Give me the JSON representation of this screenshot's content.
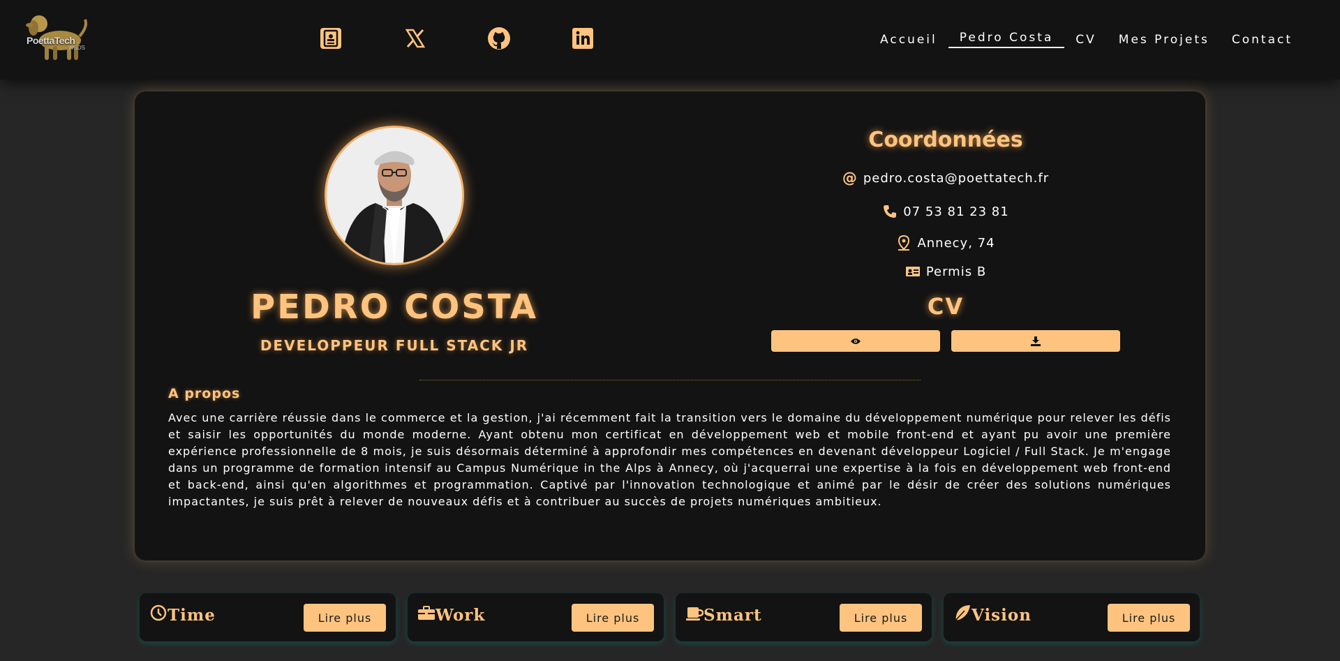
{
  "header": {
    "logo_text": "PoettaTech",
    "logo_sub": "WSDS",
    "social_icons": [
      "contact-card-icon",
      "x-icon",
      "github-icon",
      "linkedin-icon"
    ],
    "nav": [
      {
        "label": "Accueil",
        "active": false
      },
      {
        "label": "Pedro Costa",
        "active": true
      },
      {
        "label": "CV",
        "active": false
      },
      {
        "label": "Mes Projets",
        "active": false
      },
      {
        "label": "Contact",
        "active": false
      }
    ]
  },
  "profile": {
    "name": "PEDRO COSTA",
    "job": "DEVELOPPEUR FULL STACK JR"
  },
  "contact": {
    "title": "Coordonnées",
    "email": "pedro.costa@poettatech.fr",
    "phone": "07 53 81 23 81",
    "location": "Annecy, 74",
    "license": "Permis B"
  },
  "cv": {
    "title": "CV",
    "view_icon": "eye-icon",
    "download_icon": "download-icon"
  },
  "about": {
    "title": "A propos",
    "text": "Avec une carrière réussie dans le commerce et la gestion, j'ai récemment fait la transition vers le domaine du développement numérique pour relever les défis et saisir les opportunités du monde moderne. Ayant obtenu mon certificat en développement web et mobile front-end et ayant pu avoir une première expérience professionnelle de 8 mois, je suis désormais déterminé à approfondir mes compétences en devenant développeur Logiciel / Full Stack. Je m'engage dans un programme de formation intensif au Campus Numérique in the Alps à Annecy, où j'acquerrai une expertise à la fois en développement web front-end et back-end, ainsi qu'en algorithmes et programmation. Captivé par l'innovation technologique et animé par le désir de créer des solutions numériques impactantes, je suis prêt à relever de nouveaux défis et à contribuer au succès de projets numériques ambitieux."
  },
  "features": [
    {
      "title": "Time",
      "icon": "clock-icon",
      "button": "Lire plus"
    },
    {
      "title": "Work",
      "icon": "briefcase-icon",
      "button": "Lire plus"
    },
    {
      "title": "Smart",
      "icon": "mug-icon",
      "button": "Lire plus"
    },
    {
      "title": "Vision",
      "icon": "feather-icon",
      "button": "Lire plus"
    }
  ],
  "colors": {
    "accent": "#fec47f",
    "background": "#262626",
    "card": "#131313"
  }
}
